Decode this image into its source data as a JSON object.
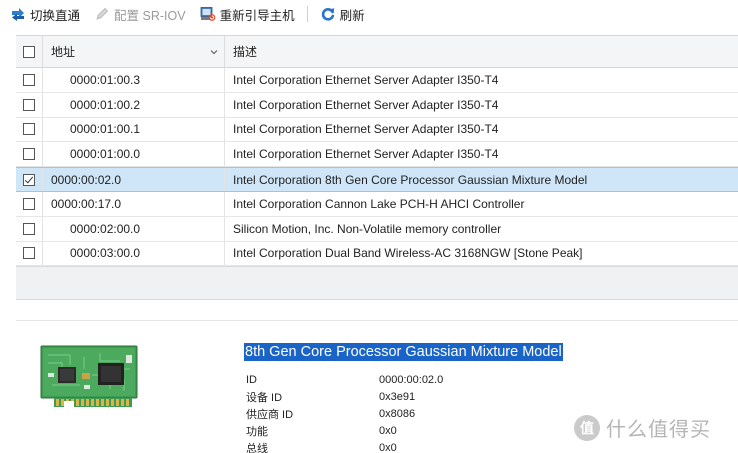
{
  "toolbar": {
    "toggle_passthrough": "切换直通",
    "configure_sriov": "配置 SR-IOV",
    "reboot_host": "重新引导主机",
    "refresh": "刷新"
  },
  "grid": {
    "columns": {
      "address": "地址",
      "description": "描述"
    },
    "rows": [
      {
        "address": "0000:01:00.3",
        "description": "Intel Corporation Ethernet Server Adapter I350-T4",
        "checked": false,
        "indent": true
      },
      {
        "address": "0000:01:00.2",
        "description": "Intel Corporation Ethernet Server Adapter I350-T4",
        "checked": false,
        "indent": true
      },
      {
        "address": "0000:01:00.1",
        "description": "Intel Corporation Ethernet Server Adapter I350-T4",
        "checked": false,
        "indent": true
      },
      {
        "address": "0000:01:00.0",
        "description": "Intel Corporation Ethernet Server Adapter I350-T4",
        "checked": false,
        "indent": true
      },
      {
        "address": "0000:00:02.0",
        "description": "Intel Corporation 8th Gen Core Processor Gaussian Mixture Model",
        "checked": true,
        "indent": false,
        "selected": true
      },
      {
        "address": "0000:00:17.0",
        "description": "Intel Corporation Cannon Lake PCH-H AHCI Controller",
        "checked": false,
        "indent": false
      },
      {
        "address": "0000:02:00.0",
        "description": "Silicon Motion, Inc. Non-Volatile memory controller",
        "checked": false,
        "indent": true
      },
      {
        "address": "0000:03:00.0",
        "description": "Intel Corporation Dual Band Wireless-AC 3168NGW [Stone Peak]",
        "checked": false,
        "indent": true
      }
    ]
  },
  "detail": {
    "title": "8th Gen Core Processor Gaussian Mixture Model",
    "props": [
      {
        "key": "ID",
        "value": "0000:00:02.0"
      },
      {
        "key": "设备 ID",
        "value": "0x3e91"
      },
      {
        "key": "供应商 ID",
        "value": "0x8086"
      },
      {
        "key": "功能",
        "value": "0x0"
      },
      {
        "key": "总线",
        "value": "0x0"
      }
    ]
  },
  "watermark": {
    "badge": "值",
    "text": "什么值得买"
  },
  "colors": {
    "selected_row": "#cfe6f8",
    "title_highlight": "#1a64c8",
    "pcb_green": "#3f9a52"
  }
}
